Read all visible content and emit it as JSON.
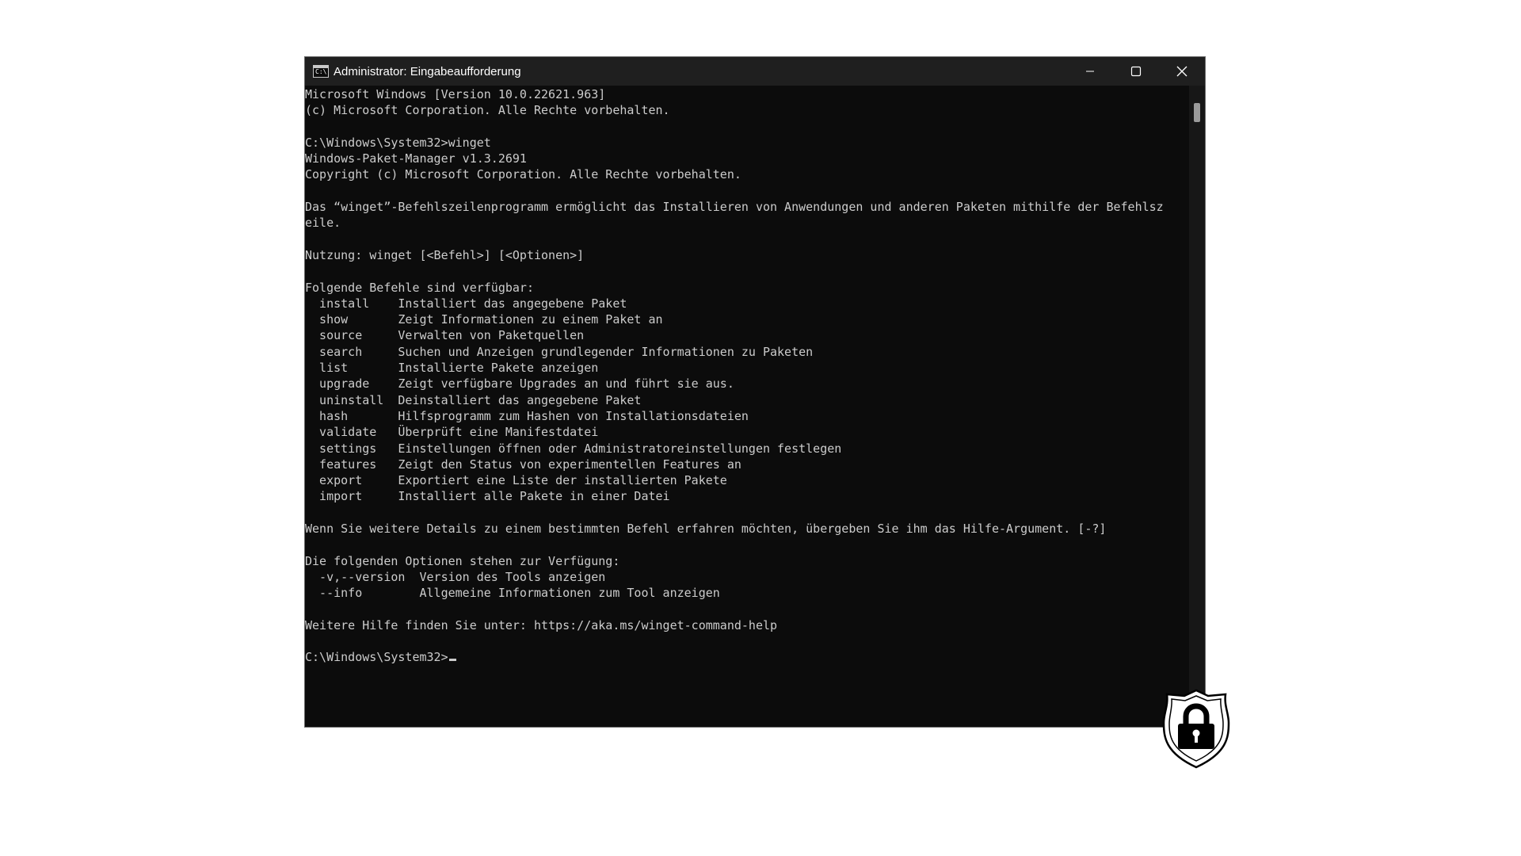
{
  "window": {
    "title": "Administrator: Eingabeaufforderung",
    "icon": "cmd-icon",
    "icon_text": "C:\\",
    "controls": [
      "minimize-icon",
      "maximize-icon",
      "close-icon"
    ]
  },
  "console": {
    "lines": [
      "Microsoft Windows [Version 10.0.22621.963]",
      "(c) Microsoft Corporation. Alle Rechte vorbehalten.",
      "",
      "C:\\Windows\\System32>winget",
      "Windows-Paket-Manager v1.3.2691",
      "Copyright (c) Microsoft Corporation. Alle Rechte vorbehalten.",
      "",
      "Das “winget”-Befehlszeilenprogramm ermöglicht das Installieren von Anwendungen und anderen Paketen mithilfe der Befehlsz",
      "eile.",
      "",
      "Nutzung: winget [<Befehl>] [<Optionen>]",
      "",
      "Folgende Befehle sind verfügbar:",
      "  install    Installiert das angegebene Paket",
      "  show       Zeigt Informationen zu einem Paket an",
      "  source     Verwalten von Paketquellen",
      "  search     Suchen und Anzeigen grundlegender Informationen zu Paketen",
      "  list       Installierte Pakete anzeigen",
      "  upgrade    Zeigt verfügbare Upgrades an und führt sie aus.",
      "  uninstall  Deinstalliert das angegebene Paket",
      "  hash       Hilfsprogramm zum Hashen von Installationsdateien",
      "  validate   Überprüft eine Manifestdatei",
      "  settings   Einstellungen öffnen oder Administratoreinstellungen festlegen",
      "  features   Zeigt den Status von experimentellen Features an",
      "  export     Exportiert eine Liste der installierten Pakete",
      "  import     Installiert alle Pakete in einer Datei",
      "",
      "Wenn Sie weitere Details zu einem bestimmten Befehl erfahren möchten, übergeben Sie ihm das Hilfe-Argument. [-?]",
      "",
      "Die folgenden Optionen stehen zur Verfügung:",
      "  -v,--version  Version des Tools anzeigen",
      "  --info        Allgemeine Informationen zum Tool anzeigen",
      "",
      "Weitere Hilfe finden Sie unter: https://aka.ms/winget-command-help",
      "",
      "C:\\Windows\\System32>"
    ]
  },
  "overlay": {
    "icon": "shield-lock-icon"
  },
  "colors": {
    "console_bg": "#0c0c0c",
    "console_text": "#cccccc",
    "titlebar_bg": "#1f1f1f",
    "page_bg": "#ffffff"
  }
}
